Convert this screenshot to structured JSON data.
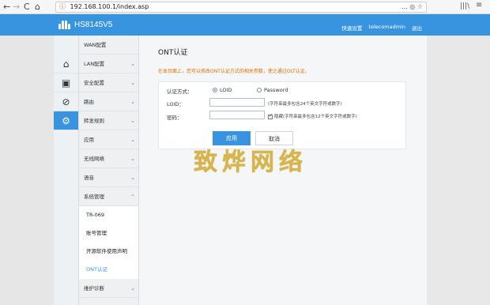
{
  "browser": {
    "url": "192.168.100.1/index.asp",
    "nav_back": "←",
    "nav_forward": "→",
    "nav_reload": "C",
    "nav_home": "⌂",
    "more": "...",
    "bookmark": "☆",
    "shield": "◎",
    "library": "|||\\",
    "menu": "≡"
  },
  "header": {
    "logo_text": "HS8145V5",
    "quick_setup": "快速设置",
    "user": "telecomadmin",
    "logout": "退出"
  },
  "rail": {
    "home": "⌂",
    "security": "▣",
    "routing": "⊘",
    "settings": "⚙"
  },
  "sidebar": {
    "items": [
      {
        "label": "WAN配置"
      },
      {
        "label": "LAN配置"
      },
      {
        "label": "安全配置"
      },
      {
        "label": "路由"
      },
      {
        "label": "转发规则"
      },
      {
        "label": "应用"
      },
      {
        "label": "无线网络"
      },
      {
        "label": "语音"
      },
      {
        "label": "系统管理"
      }
    ],
    "subitems": [
      {
        "label": "TR-069"
      },
      {
        "label": "账号管理"
      },
      {
        "label": "开源软件使用声明"
      },
      {
        "label": "ONT认证"
      }
    ],
    "last_item": "维护诊断"
  },
  "main": {
    "title": "ONT认证",
    "description": "在本页面上，您可以修改ONT认证方式的相关参数，使之通过OLT认证。",
    "auth_mode_label": "认证方式：",
    "mode_loid": "LOID",
    "mode_password": "Password",
    "loid_label": "LOID：",
    "loid_value": "",
    "loid_hint": "(字符串最多包含24个英文字符或数字)",
    "password_label": "密码：",
    "password_value": "",
    "hide_label": "隐藏(字符串最多包含12个英文字符或数字)",
    "apply_button": "应用",
    "cancel_button": "取消"
  },
  "watermark": "致烨网络",
  "colors": {
    "accent": "#3994e0",
    "desc": "#e07000"
  }
}
